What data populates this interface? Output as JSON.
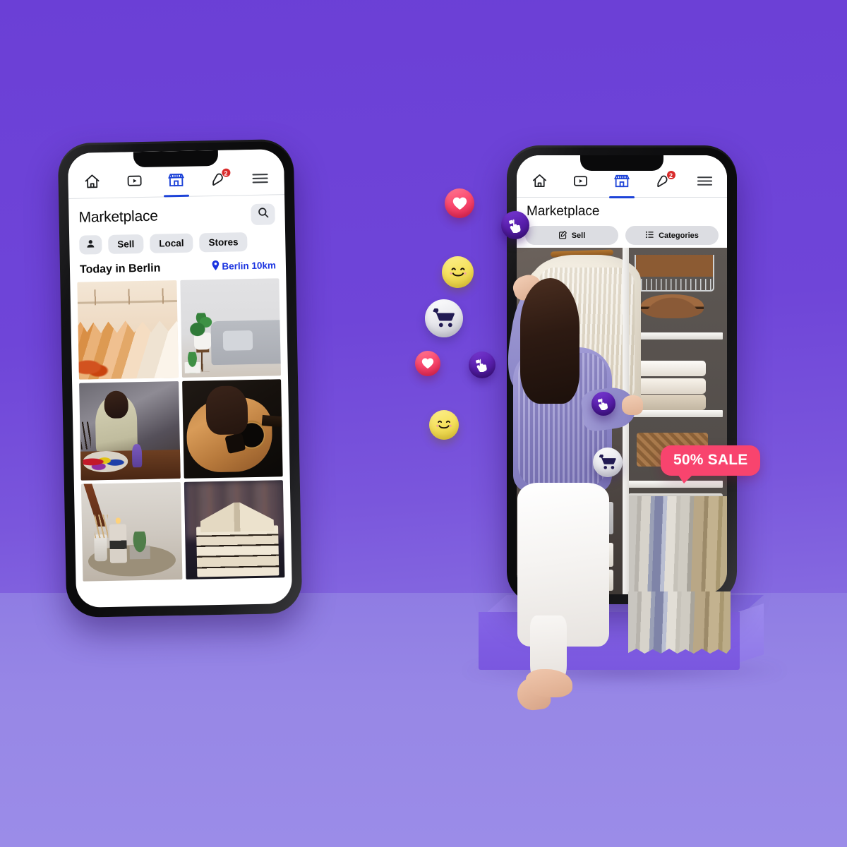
{
  "scene": {
    "background_color_top": "#6b3fd6",
    "background_color_bottom": "#9180e4",
    "pedestal_color": "#7e5ce2"
  },
  "phone_left": {
    "nav": [
      {
        "name": "home",
        "icon": "home-icon",
        "active": false,
        "badge": ""
      },
      {
        "name": "video",
        "icon": "video-icon",
        "active": false,
        "badge": ""
      },
      {
        "name": "marketplace",
        "icon": "storefront-icon",
        "active": true,
        "badge": ""
      },
      {
        "name": "notifications",
        "icon": "bell-icon",
        "active": false,
        "badge": "2"
      },
      {
        "name": "menu",
        "icon": "hamburger-menu-icon",
        "active": false,
        "badge": ""
      }
    ],
    "title": "Marketplace",
    "search_icon": "search-icon",
    "chips": [
      {
        "label": "",
        "icon": "profile-icon"
      },
      {
        "label": "Sell",
        "icon": ""
      },
      {
        "label": "Local",
        "icon": ""
      },
      {
        "label": "Stores",
        "icon": ""
      }
    ],
    "section_title": "Today in Berlin",
    "location": {
      "icon": "location-pin-icon",
      "label": "Berlin 10km",
      "color": "#1b34e0"
    },
    "grid": [
      {
        "name": "clothing-hangers",
        "alt": "Clothes on wooden hangers"
      },
      {
        "name": "gray-sofa",
        "alt": "Gray sofa with plant"
      },
      {
        "name": "woman-painting",
        "alt": "Woman painting at a table"
      },
      {
        "name": "acoustic-guitar",
        "alt": "Hands playing acoustic guitar"
      },
      {
        "name": "candles-decor",
        "alt": "Candles and home decor on tray"
      },
      {
        "name": "stacked-books",
        "alt": "Open book on a stack of books"
      }
    ]
  },
  "phone_right": {
    "nav": [
      {
        "name": "home",
        "icon": "home-icon",
        "active": false,
        "badge": ""
      },
      {
        "name": "video",
        "icon": "video-icon",
        "active": false,
        "badge": ""
      },
      {
        "name": "marketplace",
        "icon": "storefront-icon",
        "active": true,
        "badge": ""
      },
      {
        "name": "notifications",
        "icon": "bell-icon",
        "active": false,
        "badge": "2"
      },
      {
        "name": "menu",
        "icon": "hamburger-menu-icon",
        "active": false,
        "badge": ""
      }
    ],
    "title": "Marketplace",
    "buttons": [
      {
        "label": "Sell",
        "icon": "compose-icon"
      },
      {
        "label": "Categories",
        "icon": "list-icon"
      }
    ],
    "scene_alt": "Woman browsing a wardrobe full of clothes"
  },
  "sale_badge": {
    "label": "50% SALE",
    "color": "#f8446e"
  },
  "bubbles": [
    {
      "id": "b1",
      "icon": "heart-icon",
      "style": "heart"
    },
    {
      "id": "b2",
      "icon": "smiley-icon",
      "style": "smile"
    },
    {
      "id": "b3",
      "icon": "shopping-cart-icon",
      "style": "cart"
    },
    {
      "id": "b4",
      "icon": "heart-icon",
      "style": "heart"
    },
    {
      "id": "b5",
      "icon": "pointer-hand-icon",
      "style": "point"
    },
    {
      "id": "b6",
      "icon": "smiley-icon",
      "style": "smile"
    },
    {
      "id": "b7",
      "icon": "pointer-hand-icon",
      "style": "point"
    },
    {
      "id": "b8",
      "icon": "pointer-hand-icon",
      "style": "point"
    },
    {
      "id": "b9",
      "icon": "shopping-cart-icon",
      "style": "cart"
    }
  ]
}
